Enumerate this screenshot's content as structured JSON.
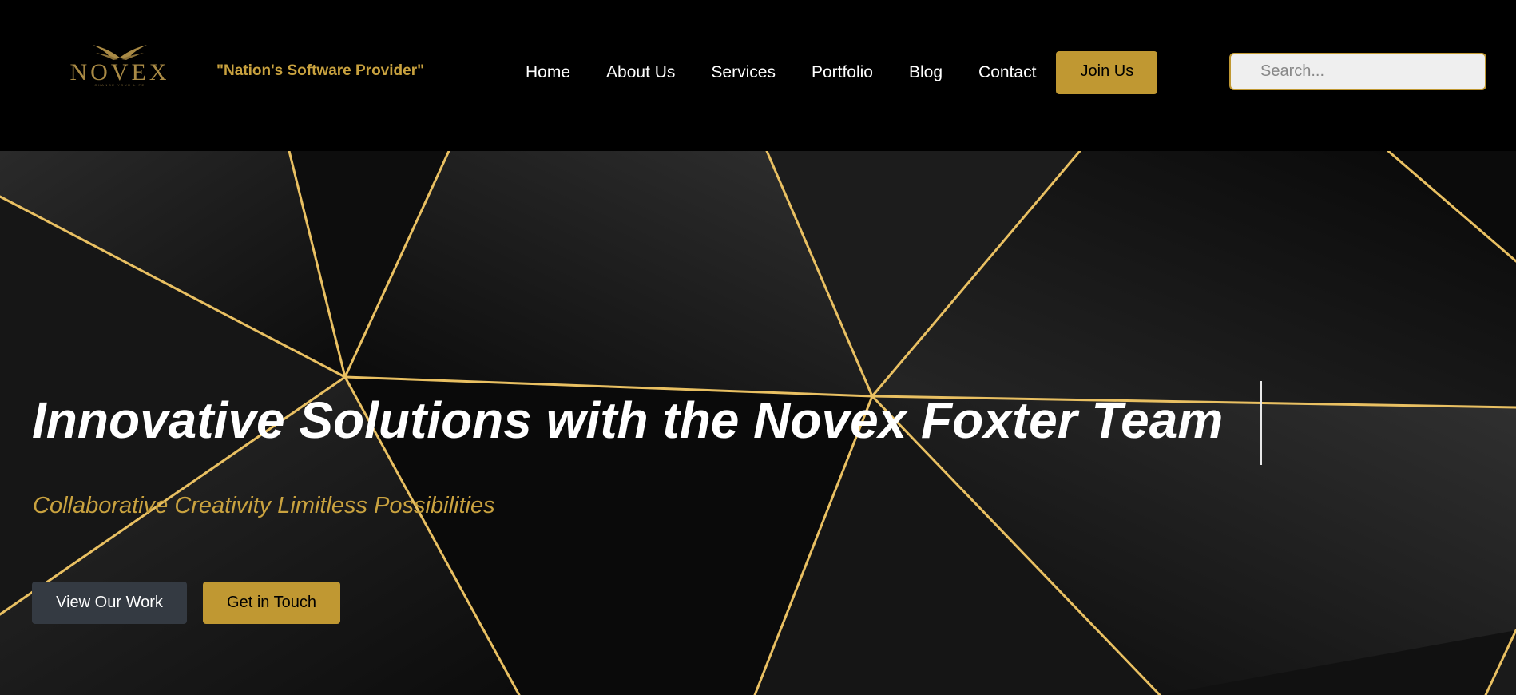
{
  "brand": {
    "logo_text": "NOVEX",
    "logo_subtext": "CHANGE YOUR LIFE",
    "tagline": "\"Nation's Software Provider\""
  },
  "nav": {
    "items": [
      "Home",
      "About Us",
      "Services",
      "Portfolio",
      "Blog",
      "Contact"
    ],
    "join_label": "Join Us"
  },
  "search": {
    "placeholder": "Search...",
    "value": ""
  },
  "hero": {
    "title": "Innovative Solutions with the Novex Foxter Team",
    "subtitle": "Collaborative Creativity Limitless Possibilities",
    "primary_button": "View Our Work",
    "secondary_button": "Get in Touch"
  },
  "colors": {
    "background": "#000000",
    "accent_gold": "#c09832",
    "gold_text": "#c9a23f",
    "dark_button": "#343a42"
  }
}
